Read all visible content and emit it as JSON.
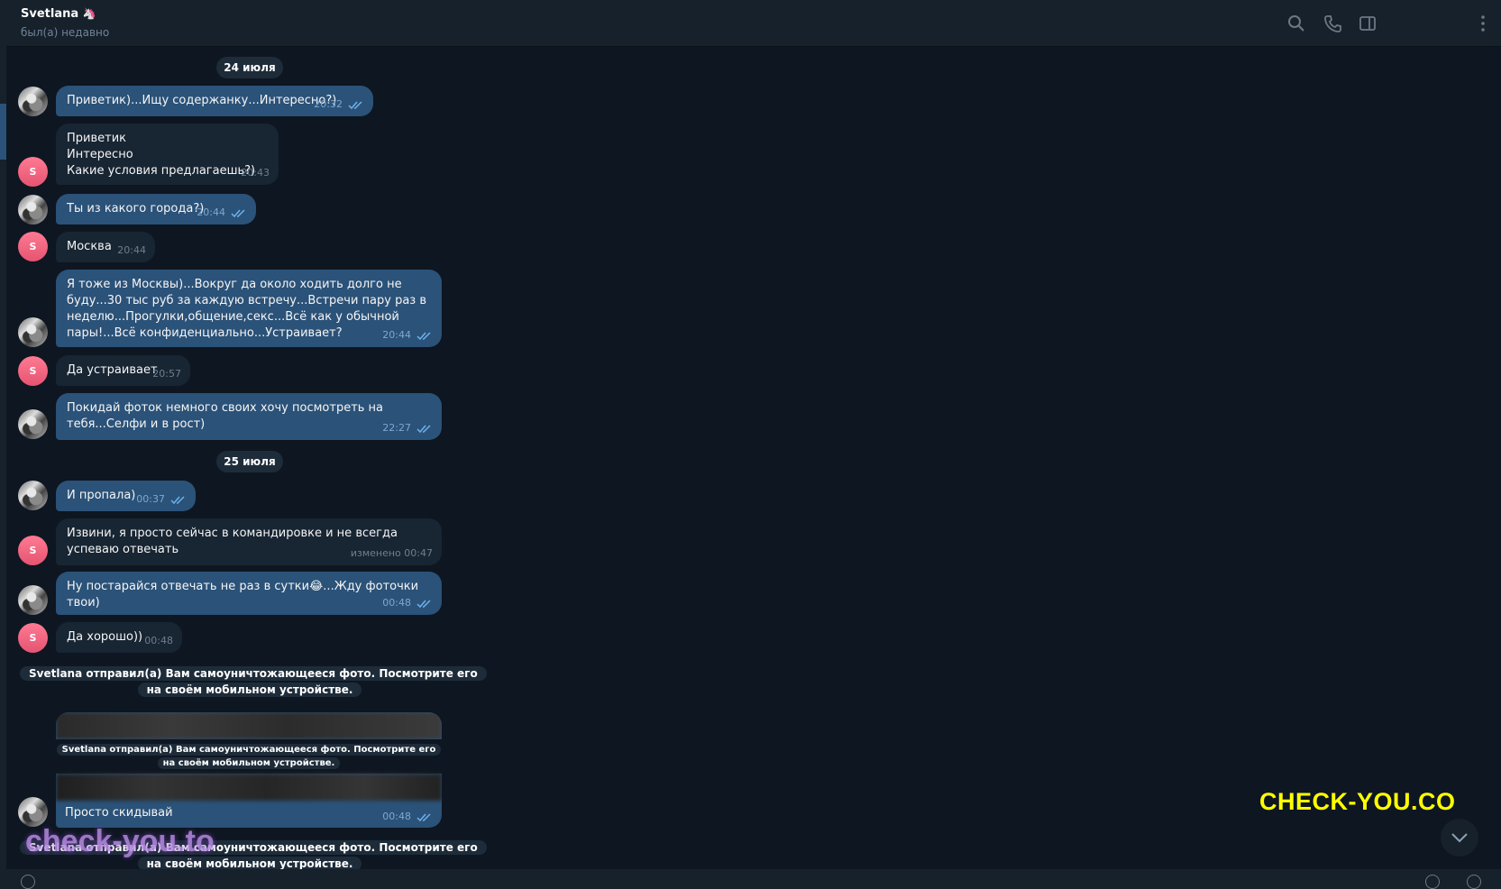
{
  "header": {
    "name": "Svetlana",
    "status": "был(а) недавно",
    "icons": [
      "search-icon",
      "phone-icon",
      "sidebar-toggle-icon",
      "more-icon"
    ]
  },
  "dates": [
    "24 июля",
    "25 июля"
  ],
  "messages": [
    {
      "dir": "out",
      "text": "Приветик)...Ищу содержанку...Интересно?)",
      "time": "20:32"
    },
    {
      "dir": "in",
      "text": "Приветик\nИнтересно\nКакие условия предлагаешь?)",
      "time": "20:43"
    },
    {
      "dir": "out",
      "text": "Ты из какого города?)",
      "time": "20:44"
    },
    {
      "dir": "in",
      "text": "Москва",
      "time": "20:44"
    },
    {
      "dir": "out",
      "text": "Я тоже из Москвы)...Вокруг да около ходить долго не буду...30 тыс руб за каждую встречу...Встречи пару раз в неделю...Прогулки,общение,секс...Всё как у обычной пары!...Всё конфиденциально...Устраивает?",
      "time": "20:44"
    },
    {
      "dir": "in",
      "text": "Да устраивает",
      "time": "20:57"
    },
    {
      "dir": "out",
      "text": "Покидай фоток немного своих хочу посмотреть на тебя...Селфи и в рост)",
      "time": "22:27"
    },
    {
      "dir": "out",
      "text": "И пропала)",
      "time": "00:37"
    },
    {
      "dir": "in",
      "text": "Извини, я просто сейчас в командировке и не всегда успеваю отвечать",
      "time": "изменено 00:47"
    },
    {
      "dir": "out",
      "text": "Ну постарайся отвечать не раз в сутки😂...Жду фоточки твои)",
      "time": "00:48"
    },
    {
      "dir": "in",
      "text": "Да хорошо))",
      "time": "00:48"
    },
    {
      "dir": "out",
      "text": "Просто скидывай",
      "time": "00:48"
    }
  ],
  "avatar_letter": "S",
  "service_message": "Svetlana отправил(а) Вам самоуничтожающееся фото. Посмотрите его на своём мобильном устройстве.",
  "watermarks": {
    "top": "CHECK-YOU.CO",
    "bottom": "check-you.to"
  },
  "colors": {
    "outgoing_bubble": "#2b5278",
    "incoming_bubble": "#182533",
    "background": "#0e1621",
    "watermark": "#ffff00"
  }
}
